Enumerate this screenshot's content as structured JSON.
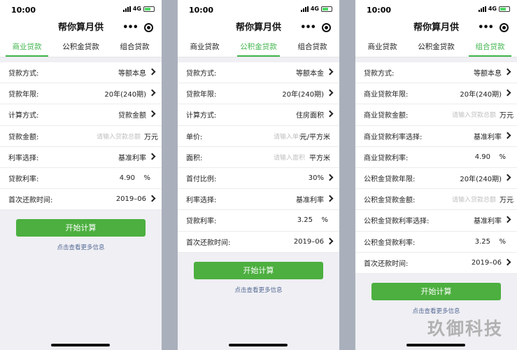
{
  "status": {
    "time": "10:00",
    "network": "4G"
  },
  "title": "帮你算月供",
  "more_icon": "•••",
  "tabs": [
    "商业贷款",
    "公积金贷款",
    "组合贷款"
  ],
  "screens": [
    {
      "active_tab": 0,
      "rows": [
        {
          "label": "贷款方式:",
          "value": "等额本息"
        },
        {
          "label": "贷款年限:",
          "value": "20年(240期)"
        },
        {
          "label": "计算方式:",
          "value": "贷款金额"
        },
        {
          "label": "贷款金额:",
          "placeholder": "请输入贷款总额",
          "unit": "万元"
        },
        {
          "label": "利率选择:",
          "value": "基准利率"
        },
        {
          "label": "贷款利率:",
          "pval": "4.90",
          "pct": "%"
        },
        {
          "label": "首次还款时间:",
          "value": "2019–06"
        }
      ],
      "button": "开始计算",
      "link": "点击查看更多信息"
    },
    {
      "active_tab": 1,
      "rows": [
        {
          "label": "贷款方式:",
          "value": "等额本金"
        },
        {
          "label": "贷款年限:",
          "value": "20年(240期)"
        },
        {
          "label": "计算方式:",
          "value": "住房面积"
        },
        {
          "label": "单价:",
          "placeholder": "请输入单价",
          "unit": "元/平方米"
        },
        {
          "label": "面积:",
          "placeholder": "请输入面积",
          "unit": "平方米"
        },
        {
          "label": "首付比例:",
          "value": "30%"
        },
        {
          "label": "利率选择:",
          "value": "基准利率"
        },
        {
          "label": "贷款利率:",
          "pval": "3.25",
          "pct": "%"
        },
        {
          "label": "首次还款时间:",
          "value": "2019–06"
        }
      ],
      "button": "开始计算",
      "link": "点击查看更多信息"
    },
    {
      "active_tab": 2,
      "rows": [
        {
          "label": "贷款方式:",
          "value": "等额本息"
        },
        {
          "label": "商业贷款年限:",
          "value": "20年(240期)"
        },
        {
          "label": "商业贷款金额:",
          "placeholder": "请输入贷款总额",
          "unit": "万元"
        },
        {
          "label": "商业贷款利率选择:",
          "value": "基准利率"
        },
        {
          "label": "商业贷款利率:",
          "pval": "4.90",
          "pct": "%"
        },
        {
          "label": "公积金贷款年限:",
          "value": "20年(240期)"
        },
        {
          "label": "公积金贷款金额:",
          "placeholder": "请输入贷款总额",
          "unit": "万元"
        },
        {
          "label": "公积金贷款利率选择:",
          "value": "基准利率"
        },
        {
          "label": "公积金贷款利率:",
          "pval": "3.25",
          "pct": "%"
        },
        {
          "label": "首次还款时间:",
          "value": "2019–06"
        }
      ],
      "button": "开始计算",
      "link": "点击查看更多信息"
    }
  ],
  "watermark": "玖御科技",
  "colors": {
    "accent": "#3fb44b",
    "button": "#4caf3f",
    "link": "#576b95"
  }
}
